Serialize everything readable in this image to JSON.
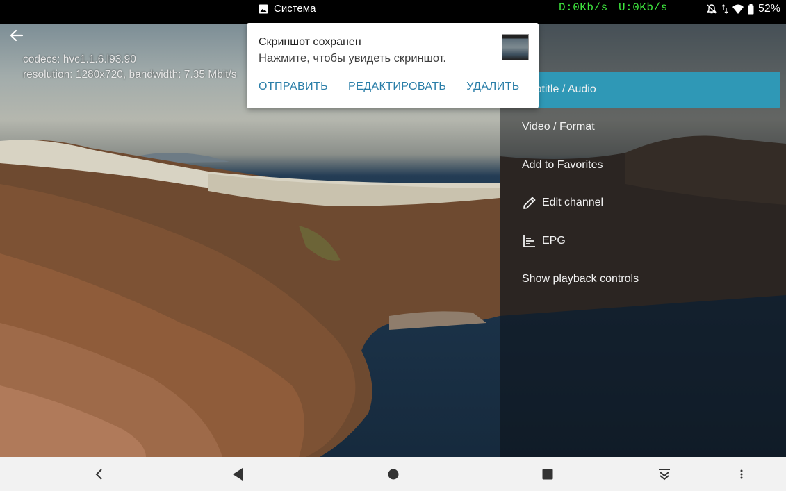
{
  "status_bar": {
    "app_name": "Система",
    "download": "D:0Kb/s",
    "upload": "U:0Kb/s",
    "battery": "52%",
    "speed_color": "#3ee63e"
  },
  "notification": {
    "title": "Скриншот сохранен",
    "text": "Нажмите, чтобы увидеть скриншот.",
    "actions": [
      "ОТПРАВИТЬ",
      "РЕДАКТИРОВАТЬ",
      "УДАЛИТЬ"
    ],
    "action_color": "#2a7ea8"
  },
  "video": {
    "codecs": "codecs: hvc1.1.6.l93.90",
    "resolution": "resolution: 1280x720, bandwidth: 7.35 Mbit/s"
  },
  "menu": {
    "accent": "#2f98b6",
    "items": [
      {
        "label": "Subtitle / Audio",
        "icon": null,
        "selected": true
      },
      {
        "label": "Video / Format",
        "icon": null,
        "selected": false
      },
      {
        "label": "Add to Favorites",
        "icon": null,
        "selected": false
      },
      {
        "label": "Edit channel",
        "icon": "pencil-icon",
        "selected": false
      },
      {
        "label": "EPG",
        "icon": "epg-list-icon",
        "selected": false
      },
      {
        "label": "Show playback controls",
        "icon": null,
        "selected": false
      }
    ]
  },
  "nav_bar": {
    "buttons": [
      "chevron-left-icon",
      "back-triangle-icon",
      "home-circle-icon",
      "recents-square-icon",
      "notification-pulldown-icon",
      "more-vert-icon"
    ]
  }
}
